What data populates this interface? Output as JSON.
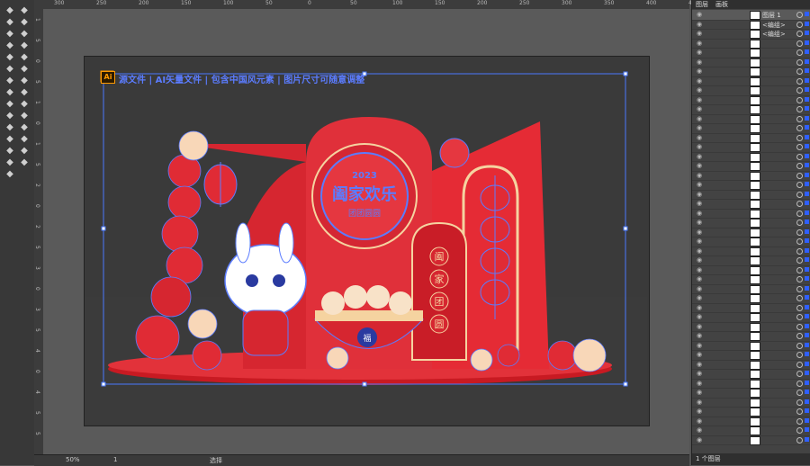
{
  "app": {
    "name": "Illustrator"
  },
  "ruler_top_ticks": [
    "300",
    "250",
    "200",
    "150",
    "100",
    "50",
    "0",
    "50",
    "100",
    "150",
    "200",
    "250",
    "300",
    "350",
    "400",
    "450"
  ],
  "ruler_left_ticks": [
    "1",
    "5",
    "0",
    "5",
    "1",
    "0",
    "1",
    "5",
    "2",
    "0",
    "2",
    "5",
    "3",
    "0",
    "3",
    "5",
    "4",
    "0",
    "4",
    "5",
    "5"
  ],
  "toolbox": {
    "icons": [
      "selection-icon",
      "direct-select-icon",
      "magic-wand-icon",
      "lasso-icon",
      "pen-icon",
      "type-icon",
      "line-icon",
      "rect-icon",
      "brush-icon",
      "pencil-icon",
      "blob-icon",
      "eraser-icon",
      "rotate-icon",
      "scale-icon",
      "width-icon",
      "free-transform-icon",
      "shape-builder-icon",
      "perspective-icon",
      "mesh-icon",
      "gradient-icon",
      "eyedropper-icon",
      "blend-icon",
      "symbol-icon",
      "graph-icon",
      "artboard-icon",
      "slice-icon",
      "hand-icon",
      "zoom-icon",
      "help-icon"
    ]
  },
  "artboard": {
    "title_banner": "源文件 | AI矢量文件 | 包含中国风元素 | 图片尺寸可随意调整",
    "ai_badge": "Ai"
  },
  "artwork": {
    "center_title_line1": "2023",
    "center_title_line2": "阖家欢乐",
    "center_title_line3": "团团圆圆",
    "vertical_text": [
      "阖",
      "家",
      "团",
      "圆"
    ],
    "bowl_char": "福"
  },
  "panel": {
    "tab_layers": "图层",
    "tab_artboards": "画板",
    "rows": [
      {
        "label": "图层 1"
      },
      {
        "label": "<编组>"
      },
      {
        "label": "<编组>"
      }
    ],
    "footer_text": "1 个图层"
  },
  "statusbar": {
    "zoom": "50%",
    "page": "1",
    "mode": "选择"
  }
}
